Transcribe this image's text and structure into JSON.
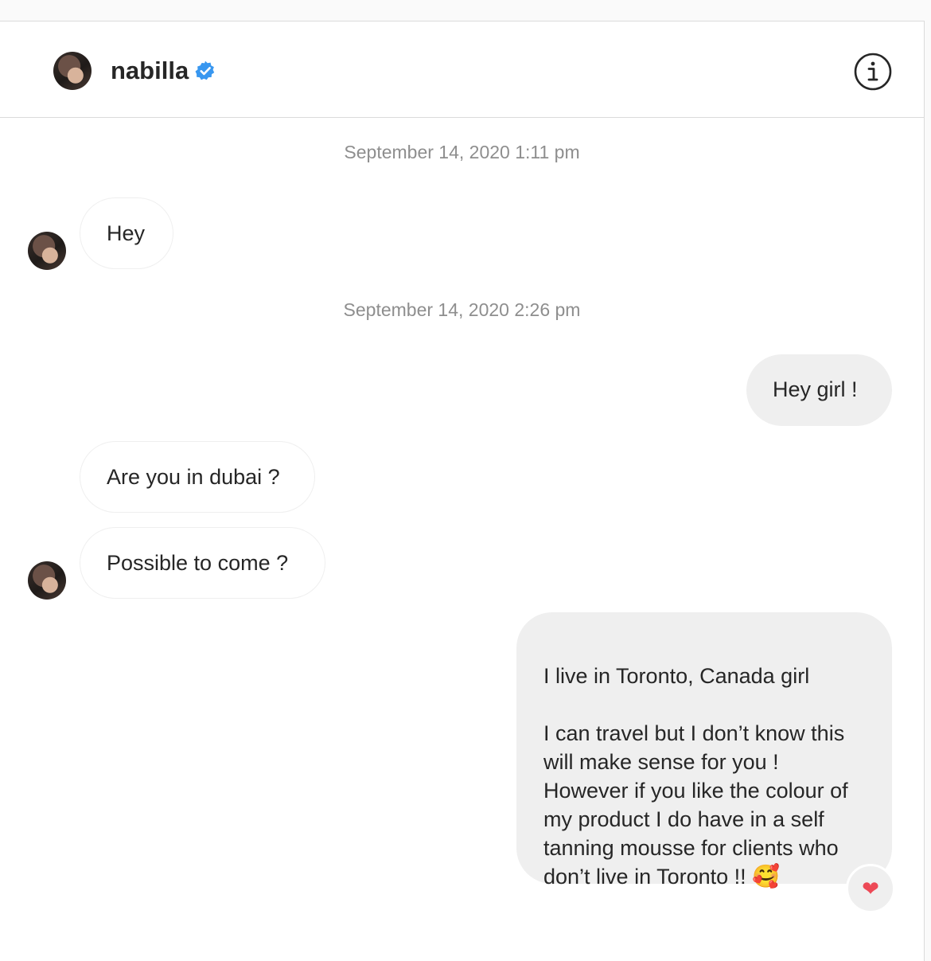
{
  "header": {
    "username": "nabilla",
    "verified": true,
    "info_icon": "info-icon"
  },
  "thread": {
    "timestamp_1": "September 14, 2020 1:11 pm",
    "timestamp_2": "September 14, 2020 2:26 pm",
    "messages": [
      {
        "direction": "incoming",
        "text": "Hey"
      },
      {
        "direction": "outgoing",
        "text": "Hey girl !"
      },
      {
        "direction": "incoming",
        "text": "Are you in dubai ?"
      },
      {
        "direction": "incoming",
        "text": "Possible to come ?"
      },
      {
        "direction": "outgoing",
        "text": "I live in Toronto, Canada girl\n\nI can travel but I don’t know this will make sense for you ! However if you like the colour of my product I do have in a self tanning mousse for clients who don’t live in Toronto !! ",
        "emoji": "🥰"
      }
    ],
    "reaction": "❤"
  },
  "colors": {
    "verified_blue": "#3897f0",
    "reaction_red": "#ed4956",
    "outgoing_bubble": "#efefef",
    "timestamp_gray": "#8e8e8e"
  }
}
